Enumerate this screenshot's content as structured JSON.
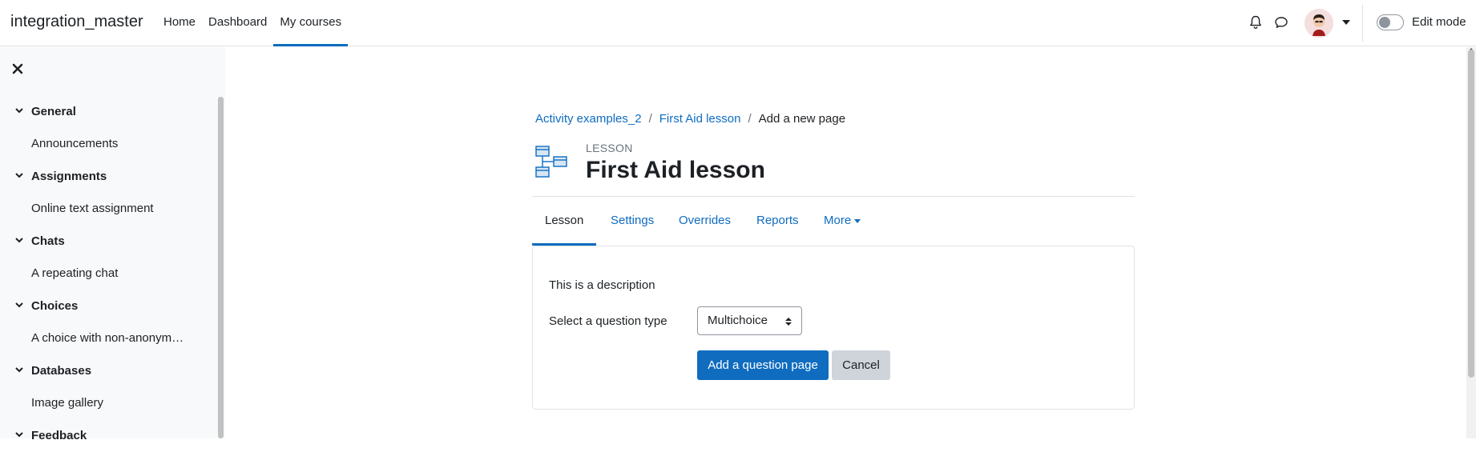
{
  "site": {
    "brand": "integration_master"
  },
  "nav": {
    "items": [
      "Home",
      "Dashboard",
      "My courses"
    ],
    "active_index": 2
  },
  "header_right": {
    "edit_mode_label": "Edit mode",
    "icons": [
      "bell-icon",
      "message-icon",
      "avatar",
      "chevron-down-icon"
    ]
  },
  "drawer": {
    "close_icon": "close-icon",
    "items": [
      {
        "type": "section",
        "label": "General"
      },
      {
        "type": "activity",
        "label": "Announcements"
      },
      {
        "type": "section",
        "label": "Assignments"
      },
      {
        "type": "activity",
        "label": "Online text assignment"
      },
      {
        "type": "section",
        "label": "Chats"
      },
      {
        "type": "activity",
        "label": "A repeating chat"
      },
      {
        "type": "section",
        "label": "Choices"
      },
      {
        "type": "activity",
        "label": "A choice with non-anonym…"
      },
      {
        "type": "section",
        "label": "Databases"
      },
      {
        "type": "activity",
        "label": "Image gallery"
      },
      {
        "type": "section",
        "label": "Feedback"
      }
    ]
  },
  "breadcrumb": {
    "items": [
      "Activity examples_2",
      "First Aid lesson"
    ],
    "current": "Add a new page"
  },
  "page": {
    "module_type": "LESSON",
    "title": "First Aid lesson"
  },
  "tabs": {
    "items": [
      "Lesson",
      "Settings",
      "Overrides",
      "Reports",
      "More"
    ],
    "active_index": 0
  },
  "form": {
    "description": "This is a description",
    "question_type_label": "Select a question type",
    "question_type_value": "Multichoice",
    "submit_label": "Add a question page",
    "cancel_label": "Cancel"
  },
  "colors": {
    "primary": "#0f6cbf",
    "drawer_bg": "#f8f9fa",
    "secondary_btn": "#ced4da"
  }
}
